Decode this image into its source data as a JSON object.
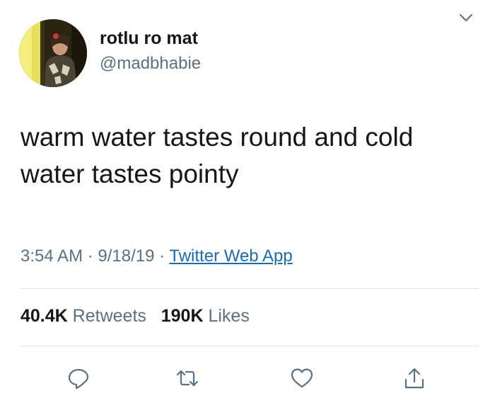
{
  "author": {
    "display_name": "rotlu ro mat",
    "handle": "@madbhabie",
    "avatar_icon": "profile-photo"
  },
  "tweet": {
    "text": "warm water tastes round and cold water tastes pointy",
    "time": "3:54 AM",
    "separator": "·",
    "date": "9/18/19",
    "source": "Twitter Web App"
  },
  "stats": {
    "retweets_count": "40.4K",
    "retweets_label": "Retweets",
    "likes_count": "190K",
    "likes_label": "Likes"
  },
  "actions": {
    "reply_icon": "speech-bubble-icon",
    "retweet_icon": "retweet-arrows-icon",
    "like_icon": "heart-icon",
    "share_icon": "share-arrow-icon"
  },
  "colors": {
    "text_primary": "#14171a",
    "text_secondary": "#5b7083",
    "link": "#1a6bb0",
    "divider": "#dfe3e7"
  }
}
